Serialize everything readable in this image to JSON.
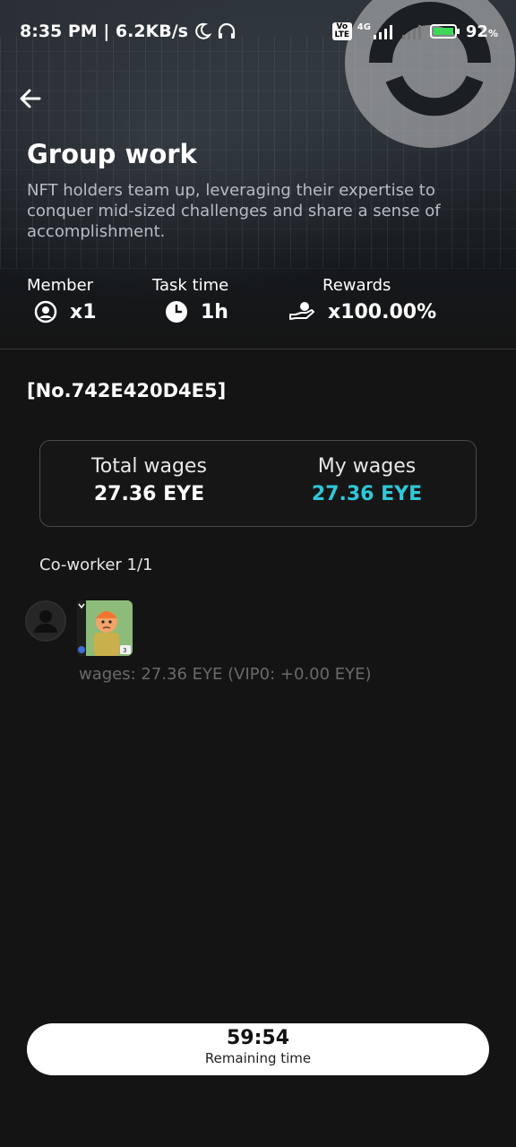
{
  "status_bar": {
    "time_speed": "8:35 PM | 6.2KB/s",
    "network_tag": "4G",
    "volte_tag": "Vo LTE",
    "battery": "92",
    "battery_unit": "%"
  },
  "header": {
    "title": "Group work",
    "description": "NFT holders team up, leveraging their expertise to conquer mid-sized challenges and share a sense of accomplishment."
  },
  "stats": {
    "member_label": "Member",
    "member_value": "x1",
    "task_time_label": "Task time",
    "task_time_value": "1h",
    "rewards_label": "Rewards",
    "rewards_value": "x100.00%"
  },
  "task_id": "[No.742E420D4E5]",
  "wages": {
    "total_label": "Total wages",
    "total_value": "27.36 EYE",
    "my_label": "My wages",
    "my_value": "27.36 EYE",
    "accent_color": "#2ec8d8"
  },
  "coworker": {
    "label": "Co-worker 1/1",
    "wages_line": "wages: 27.36 EYE (VIP0: +0.00 EYE)",
    "nft_level": "3"
  },
  "timer": {
    "value": "59:54",
    "label": "Remaining time"
  },
  "icons": [
    "back-arrow-icon",
    "person-circle-icon",
    "clock-icon",
    "hand-reward-icon",
    "moon-icon",
    "headphones-icon",
    "signal-icon",
    "battery-icon",
    "avatar-placeholder-icon"
  ]
}
